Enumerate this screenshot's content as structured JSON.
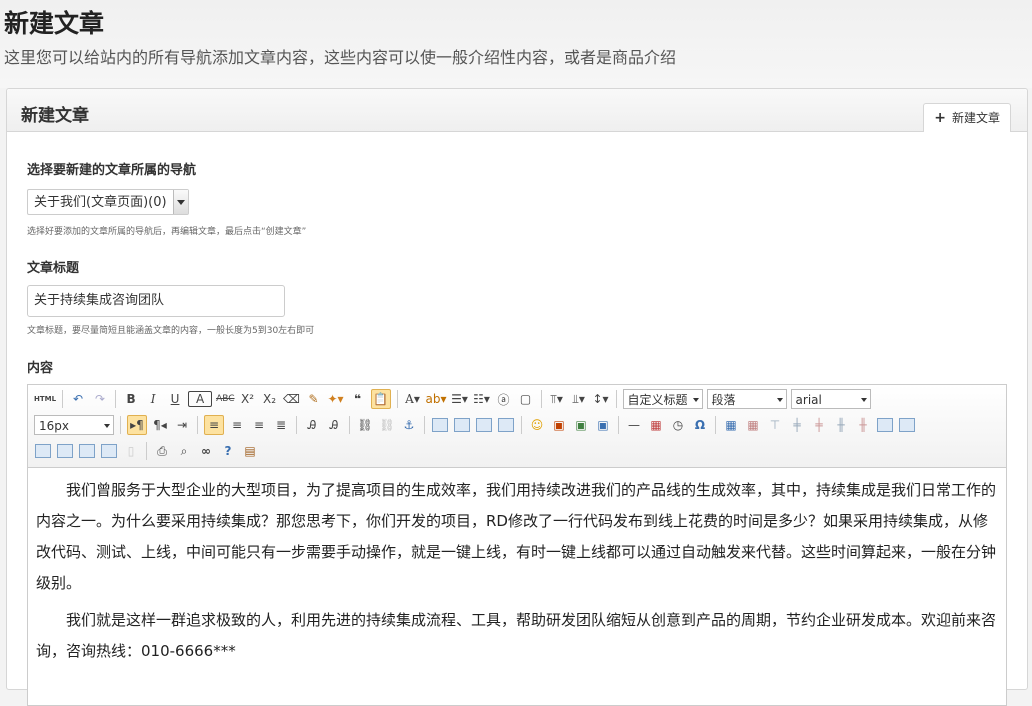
{
  "header": {
    "title": "新建文章",
    "subtitle": "这里您可以给站内的所有导航添加文章内容，这些内容可以使一般介绍性内容，或者是商品介绍"
  },
  "panel": {
    "title": "新建文章",
    "tab_label": "新建文章"
  },
  "form": {
    "nav_label": "选择要新建的文章所属的导航",
    "nav_selected": "关于我们(文章页面)(0)",
    "nav_hint": "选择好要添加的文章所属的导航后，再编辑文章，最后点击“创建文章”",
    "title_label": "文章标题",
    "title_value": "关于持续集成咨询团队",
    "title_hint": "文章标题，要尽量简短且能涵盖文章的内容，一般长度为5到30左右即可",
    "content_label": "内容"
  },
  "toolbar": {
    "html_label": "HTML",
    "heading_select": "自定义标题",
    "paragraph_select": "段落",
    "font_select": "arial",
    "size_select": "16px"
  },
  "content": {
    "paragraphs": [
      "我们曾服务于大型企业的大型项目，为了提高项目的生成效率，我们用持续改进我们的产品线的生成效率，其中，持续集成是我们日常工作的内容之一。为什么要采用持续集成？那您思考下，你们开发的项目，RD修改了一行代码发布到线上花费的时间是多少？如果采用持续集成，从修改代码、测试、上线，中间可能只有一步需要手动操作，就是一键上线，有时一键上线都可以通过自动触发来代替。这些时间算起来，一般在分钟级别。",
      "我们就是这样一群追求极致的人，利用先进的持续集成流程、工具，帮助研发团队缩短从创意到产品的周期，节约企业研发成本。欢迎前来咨询，咨询热线：010-6666***"
    ]
  }
}
